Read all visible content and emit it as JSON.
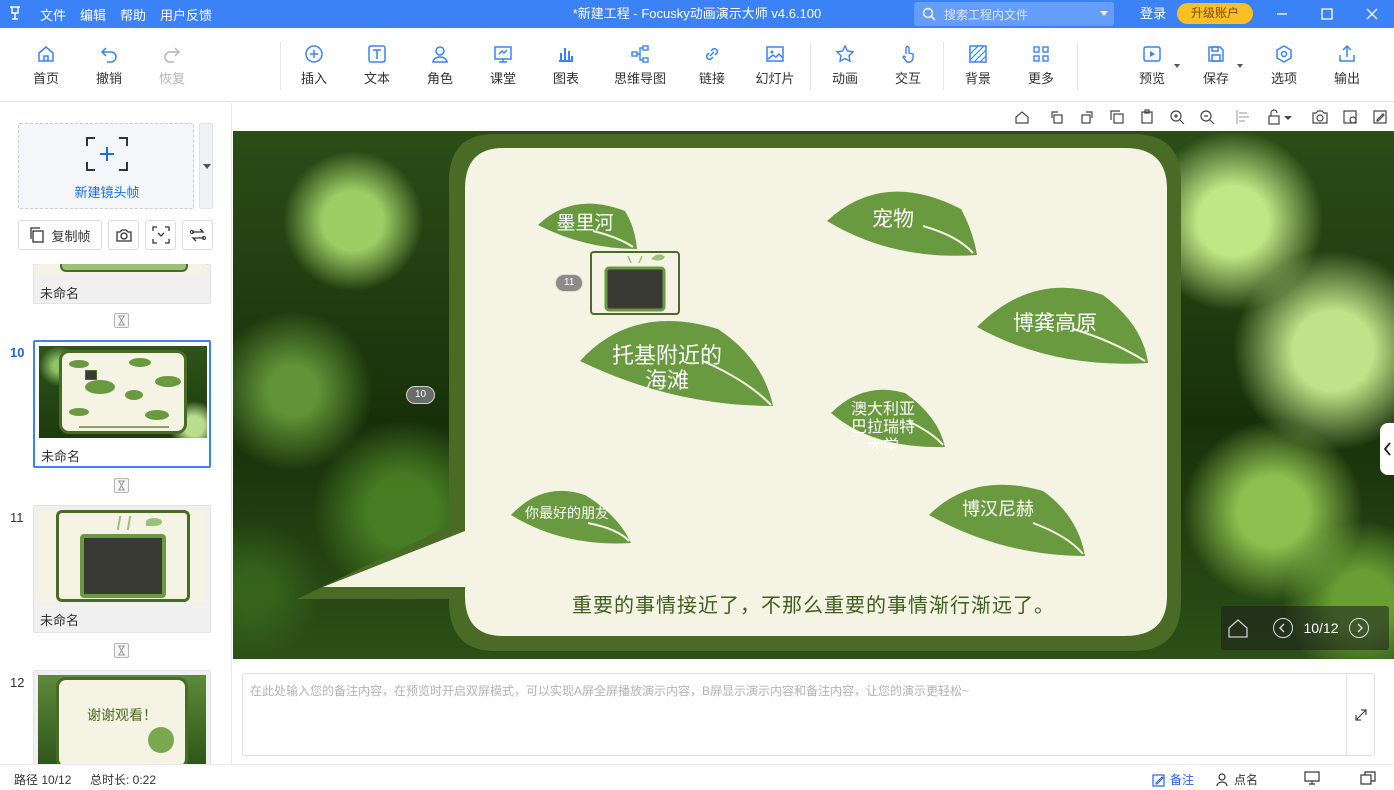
{
  "titlebar": {
    "menu": [
      "文件",
      "编辑",
      "帮助",
      "用户反馈"
    ],
    "title": "*新建工程 - Focusky动画演示大师  v4.6.100",
    "search_placeholder": "搜索工程内文件",
    "login": "登录",
    "upgrade": "升级账户"
  },
  "toolbar": {
    "home": "首页",
    "undo": "撤销",
    "redo": "恢复",
    "insert": "插入",
    "text": "文本",
    "role": "角色",
    "class": "课堂",
    "chart": "图表",
    "mindmap": "思维导图",
    "link": "链接",
    "slides": "幻灯片",
    "animation": "动画",
    "interaction": "交互",
    "background": "背景",
    "more": "更多",
    "preview": "预览",
    "save": "保存",
    "options": "选项",
    "export": "输出"
  },
  "left_panel": {
    "new_frame": "新建镜头帧",
    "copy_frame": "复制帧",
    "thumbnails": [
      {
        "num": "",
        "name": "未命名"
      },
      {
        "num": "10",
        "name": "未命名"
      },
      {
        "num": "11",
        "name": "未命名"
      },
      {
        "num": "12",
        "name": "",
        "text": "谢谢观看！"
      }
    ]
  },
  "slide": {
    "leaves": [
      "墨里河",
      "宠物",
      "托基附近的\n海滩",
      "博龚高原",
      "澳大利亚\n巴拉瑞特\n大学",
      "你最好的朋友",
      "博汉尼赫"
    ],
    "caption": "重要的事情接近了，不那么重要的事情渐行渐远了。",
    "path_badges": [
      "11",
      "10"
    ],
    "page_indicator": "10/12"
  },
  "notes": {
    "placeholder": "在此处输入您的备注内容，在预览时开启双屏模式，可以实现A屏全屏播放演示内容，B屏显示演示内容和备注内容，让您的演示更轻松~"
  },
  "status": {
    "path": "路径 10/12",
    "duration": "总时长: 0:22",
    "notes": "备注",
    "rollcall": "点名"
  },
  "colors": {
    "accent": "#3b82f6",
    "leaf_green": "#6a9a40",
    "frame_dark": "#4a6b25",
    "paper": "#f5f3e3"
  }
}
